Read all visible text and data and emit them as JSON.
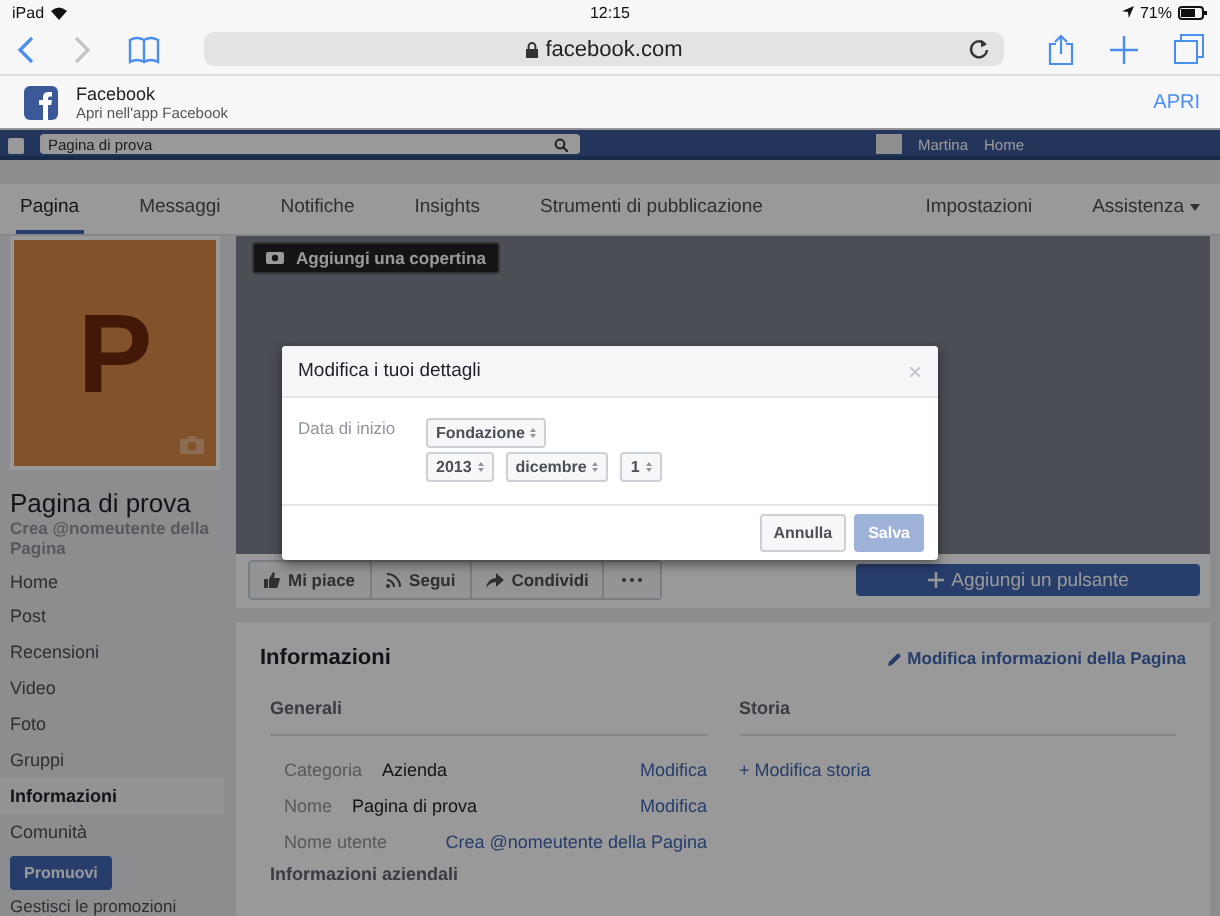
{
  "status_bar": {
    "device": "iPad",
    "time": "12:15",
    "battery": "71%"
  },
  "browser": {
    "url": "facebook.com"
  },
  "app_banner": {
    "app_name": "Facebook",
    "subtitle": "Apri nell'app Facebook",
    "action": "APRI"
  },
  "fb_header": {
    "search": "Pagina di prova",
    "user": "Martina",
    "home": "Home"
  },
  "tabs": [
    {
      "label": "Pagina",
      "selected": true
    },
    {
      "label": "Messaggi",
      "selected": false
    },
    {
      "label": "Notifiche",
      "selected": false
    },
    {
      "label": "Insights",
      "selected": false
    },
    {
      "label": "Strumenti di pubblicazione",
      "selected": false
    }
  ],
  "right_tabs": [
    {
      "label": "Impostazioni",
      "dropdown": false
    },
    {
      "label": "Assistenza",
      "dropdown": true
    }
  ],
  "profile": {
    "initial": "P",
    "name": "Pagina di prova",
    "username_link": "Crea @nomeutente della Pagina"
  },
  "sidebar": {
    "items": [
      {
        "label": "Home",
        "selected": false
      },
      {
        "label": "Post",
        "selected": false
      },
      {
        "label": "Recensioni",
        "selected": false
      },
      {
        "label": "Video",
        "selected": false
      },
      {
        "label": "Foto",
        "selected": false
      },
      {
        "label": "Gruppi",
        "selected": false
      },
      {
        "label": "Informazioni",
        "selected": true
      },
      {
        "label": "Comunità",
        "selected": false
      }
    ],
    "promote_button": "Promuovi",
    "manage_link": "Gestisci le promozioni"
  },
  "cover": {
    "button": "Aggiungi una copertina"
  },
  "actions": [
    {
      "kind": "like",
      "label": "Mi piace"
    },
    {
      "kind": "follow",
      "label": "Segui"
    },
    {
      "kind": "share",
      "label": "Condividi"
    },
    {
      "kind": "more"
    }
  ],
  "add_button": "Aggiungi un pulsante",
  "about": {
    "title": "Informazioni",
    "edit_link": "Modifica informazioni della Pagina",
    "general": {
      "heading": "Generali",
      "rows": [
        {
          "label": "Categoria",
          "value": "Azienda",
          "kind": "text",
          "action": "Modifica"
        },
        {
          "label": "Nome",
          "value": "Pagina di prova",
          "kind": "text",
          "action": "Modifica"
        },
        {
          "label": "Nome utente",
          "value": "Crea @nomeutente della Pagina",
          "kind": "link"
        }
      ]
    },
    "business_heading": "Informazioni aziendali",
    "story": {
      "heading": "Storia",
      "link": "+ Modifica storia"
    }
  },
  "modal": {
    "title": "Modifica i tuoi dettagli",
    "close": "×",
    "field_label": "Data di inizio",
    "select_rows": [
      [
        "Fondazione"
      ],
      [
        "2013",
        "dicembre",
        "1"
      ]
    ],
    "buttons": [
      {
        "label": "Annulla",
        "kind": "secondary",
        "disabled": false
      },
      {
        "label": "Salva",
        "kind": "primary",
        "disabled": true
      }
    ]
  }
}
